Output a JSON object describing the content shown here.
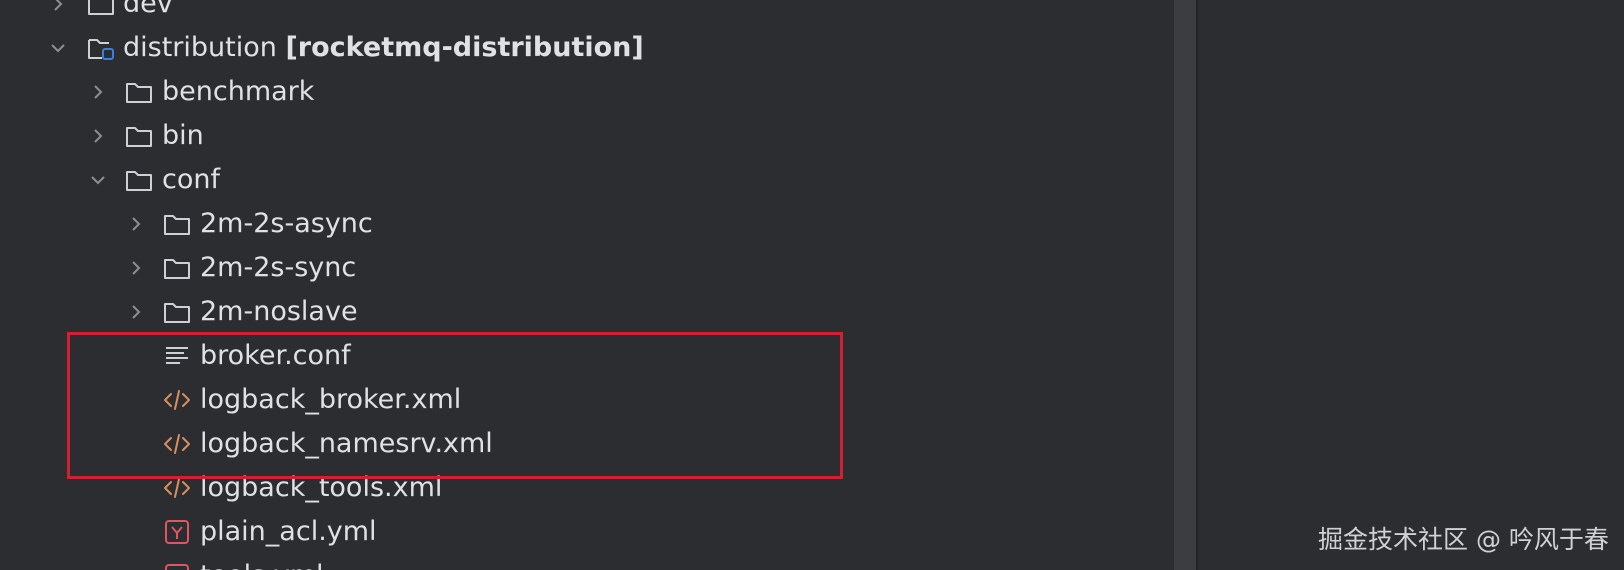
{
  "tree": {
    "partial_top": "dev",
    "module": {
      "name": "distribution",
      "qualifier": "[rocketmq-distribution]"
    },
    "items": [
      {
        "label": "benchmark"
      },
      {
        "label": "bin"
      },
      {
        "label": "conf"
      },
      {
        "label": "2m-2s-async"
      },
      {
        "label": "2m-2s-sync"
      },
      {
        "label": "2m-noslave"
      },
      {
        "label": "broker.conf"
      },
      {
        "label": "logback_broker.xml"
      },
      {
        "label": "logback_namesrv.xml"
      },
      {
        "label": "logback_tools.xml"
      },
      {
        "label": "plain_acl.yml"
      },
      {
        "label": "tools.yml"
      }
    ]
  },
  "icons": {
    "folder": "folder-icon",
    "module": "module-folder-icon",
    "text_file": "text-file-icon",
    "xml_file": "xml-file-icon",
    "yaml_file": "yaml-file-icon",
    "expand": "chevron-right-icon",
    "collapse": "chevron-down-icon"
  },
  "colors": {
    "background": "#2b2d30",
    "text": "#dfe1e5",
    "highlight_border": "#d11f33",
    "xml_icon": "#d98f5f",
    "yaml_icon": "#e05561",
    "module_badge": "#3d7fe0"
  },
  "watermark": "掘金技术社区 @ 吟风于春"
}
